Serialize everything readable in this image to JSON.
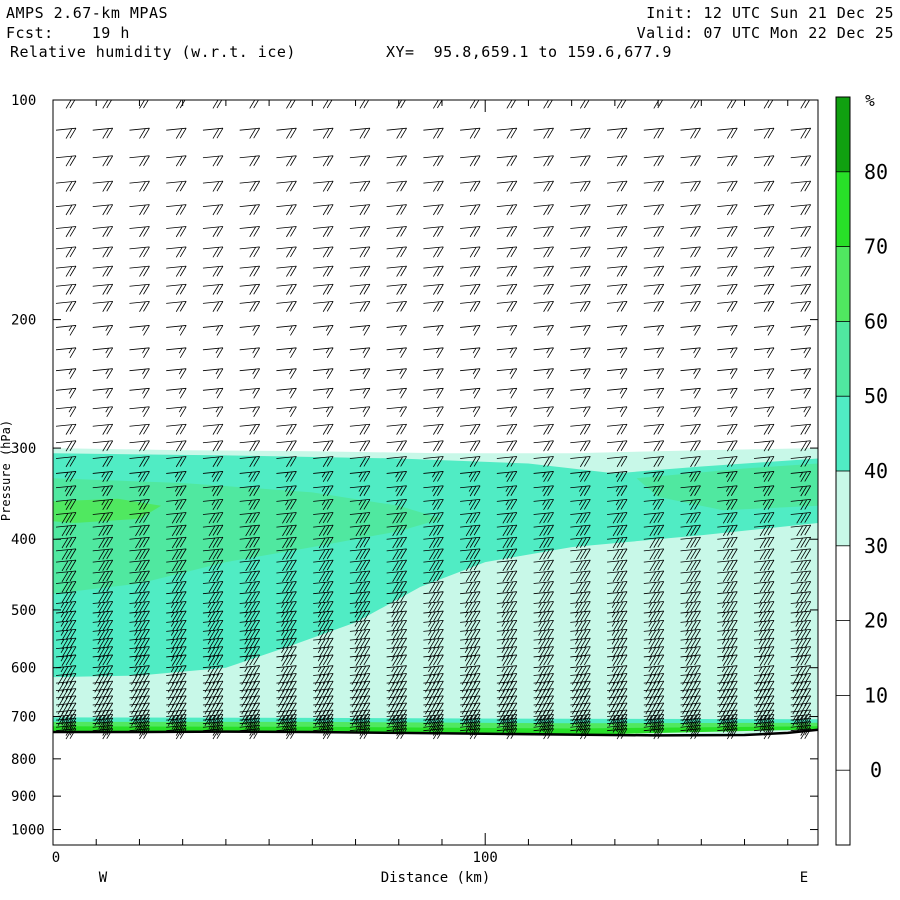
{
  "header": {
    "model": "AMPS 2.67-km MPAS",
    "fcst_label": "Fcst:",
    "fcst_value": "19 h",
    "field": "Relative humidity (w.r.t. ice)",
    "xy_label": "XY=",
    "xy_value": "95.8,659.1 to 159.6,677.9",
    "init": "Init: 12 UTC Sun 21 Dec 25",
    "valid": "Valid: 07 UTC Mon 22 Dec 25"
  },
  "chart_data": {
    "type": "heatmap",
    "title": "Relative humidity (w.r.t. ice)",
    "xlabel": "Distance (km)",
    "ylabel": "Pressure (hPa)",
    "xlim": [
      0,
      177
    ],
    "ylim": [
      100,
      1050
    ],
    "y_scale": "log",
    "y_reversed": true,
    "x_ticks": [
      0,
      100
    ],
    "x_minor_step_km": 10,
    "y_ticks": [
      100,
      200,
      300,
      400,
      500,
      600,
      700,
      800,
      900,
      1000
    ],
    "direction_labels": {
      "left": "W",
      "right": "E"
    },
    "colorbar": {
      "unit": "%",
      "levels": [
        0,
        10,
        20,
        30,
        40,
        50,
        60,
        70,
        80
      ],
      "colors": [
        "#ffffff",
        "#ffffff",
        "#ffffff",
        "#ffffff",
        "#c8f8e8",
        "#50ecc4",
        "#50e8a0",
        "#50e860",
        "#28e028",
        "#10a010"
      ]
    },
    "terrain_pressure": [
      {
        "x": 0,
        "p": 735
      },
      {
        "x": 20,
        "p": 735
      },
      {
        "x": 40,
        "p": 734
      },
      {
        "x": 60,
        "p": 735
      },
      {
        "x": 80,
        "p": 737
      },
      {
        "x": 100,
        "p": 739
      },
      {
        "x": 120,
        "p": 741
      },
      {
        "x": 140,
        "p": 743
      },
      {
        "x": 160,
        "p": 742
      },
      {
        "x": 170,
        "p": 737
      },
      {
        "x": 177,
        "p": 730
      }
    ],
    "rh_regions": [
      {
        "rh": 35,
        "points": [
          [
            0,
            300
          ],
          [
            30,
            302
          ],
          [
            60,
            303
          ],
          [
            90,
            305
          ],
          [
            120,
            305
          ],
          [
            150,
            302
          ],
          [
            177,
            300
          ],
          [
            177,
            728
          ],
          [
            160,
            740
          ],
          [
            120,
            738
          ],
          [
            80,
            735
          ],
          [
            40,
            733
          ],
          [
            0,
            733
          ]
        ]
      },
      {
        "rh": 45,
        "points": [
          [
            0,
            305
          ],
          [
            40,
            307
          ],
          [
            80,
            310
          ],
          [
            110,
            315
          ],
          [
            130,
            325
          ],
          [
            150,
            318
          ],
          [
            177,
            310
          ],
          [
            177,
            380
          ],
          [
            150,
            395
          ],
          [
            120,
            410
          ],
          [
            100,
            430
          ],
          [
            85,
            465
          ],
          [
            70,
            520
          ],
          [
            55,
            560
          ],
          [
            40,
            600
          ],
          [
            20,
            615
          ],
          [
            0,
            618
          ]
        ]
      },
      {
        "rh": 55,
        "points": [
          [
            0,
            330
          ],
          [
            30,
            335
          ],
          [
            60,
            345
          ],
          [
            80,
            360
          ],
          [
            90,
            375
          ],
          [
            80,
            390
          ],
          [
            60,
            410
          ],
          [
            40,
            430
          ],
          [
            20,
            460
          ],
          [
            0,
            475
          ]
        ]
      },
      {
        "rh": 55,
        "points": [
          [
            135,
            330
          ],
          [
            160,
            320
          ],
          [
            177,
            315
          ],
          [
            177,
            360
          ],
          [
            155,
            365
          ],
          [
            140,
            350
          ]
        ]
      },
      {
        "rh": 65,
        "points": [
          [
            0,
            355
          ],
          [
            15,
            352
          ],
          [
            25,
            360
          ],
          [
            20,
            375
          ],
          [
            5,
            380
          ],
          [
            0,
            378
          ]
        ]
      },
      {
        "rh": 45,
        "points": [
          [
            0,
            702
          ],
          [
            60,
            703
          ],
          [
            120,
            705
          ],
          [
            177,
            706
          ],
          [
            177,
            725
          ],
          [
            120,
            736
          ],
          [
            60,
            732
          ],
          [
            0,
            732
          ]
        ]
      },
      {
        "rh": 65,
        "points": [
          [
            0,
            712
          ],
          [
            60,
            712
          ],
          [
            120,
            715
          ],
          [
            177,
            714
          ],
          [
            177,
            727
          ],
          [
            120,
            740
          ],
          [
            60,
            735
          ],
          [
            0,
            735
          ]
        ]
      },
      {
        "rh": 75,
        "points": [
          [
            0,
            722
          ],
          [
            60,
            723
          ],
          [
            120,
            727
          ],
          [
            177,
            722
          ],
          [
            177,
            729
          ],
          [
            120,
            742
          ],
          [
            60,
            736
          ],
          [
            0,
            736
          ]
        ]
      }
    ],
    "wind_barb_columns_x_km": [
      0,
      8.5,
      17,
      25.5,
      34,
      42.5,
      51,
      59.5,
      68,
      76.5,
      85,
      93.5,
      102,
      110.5,
      119,
      127.5,
      136,
      144.5,
      153,
      161.5,
      170,
      177
    ],
    "wind_barb_levels_hpa": [
      100,
      110,
      120,
      130,
      140,
      150,
      160,
      170,
      180,
      190,
      205,
      220,
      235,
      250,
      265,
      280,
      295,
      310,
      325,
      340,
      355,
      370,
      385,
      400,
      415,
      430,
      445,
      460,
      475,
      490,
      505,
      520,
      535,
      550,
      565,
      580,
      600,
      615,
      630,
      645,
      660,
      675,
      690,
      700,
      708,
      716,
      724,
      732
    ],
    "wind_speed_kt_by_level": [
      20,
      20,
      20,
      20,
      20,
      20,
      20,
      20,
      20,
      20,
      15,
      15,
      15,
      15,
      15,
      20,
      20,
      20,
      25,
      25,
      25,
      30,
      30,
      30,
      30,
      30,
      30,
      30,
      30,
      35,
      35,
      35,
      35,
      35,
      35,
      35,
      35,
      40,
      40,
      40,
      40,
      40,
      40,
      40,
      35,
      30,
      25,
      20
    ]
  }
}
